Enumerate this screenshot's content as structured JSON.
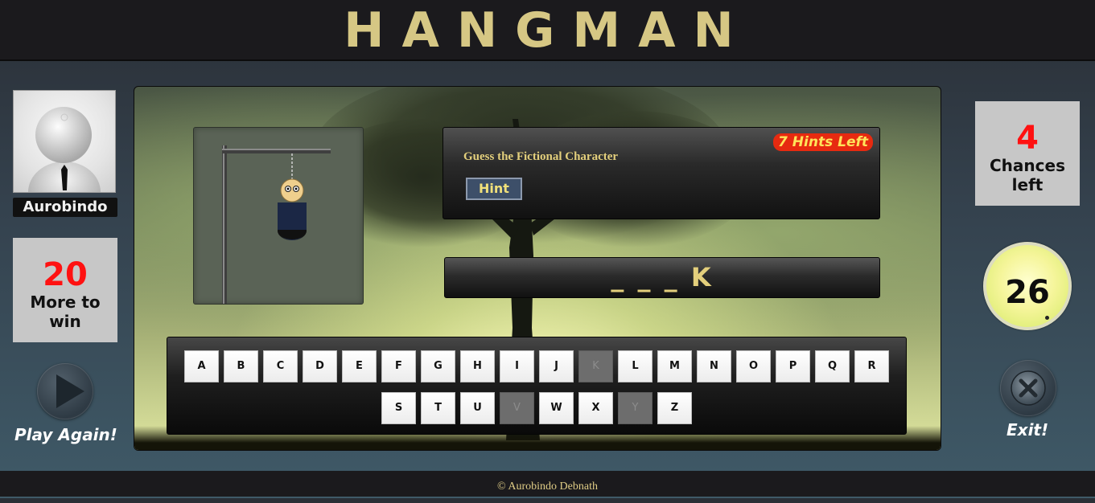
{
  "app": {
    "title": "HANGMAN"
  },
  "player": {
    "name": "Aurobindo"
  },
  "stats": {
    "more_to_win": "20",
    "more_to_win_label": "More to win",
    "chances_left": "4",
    "chances_left_label": "Chances left",
    "timer": "26"
  },
  "actions": {
    "play_again": "Play Again!",
    "exit": "Exit!"
  },
  "question": {
    "category": "Guess the Fictional Character",
    "hints_left": "7 Hints Left",
    "hint_button": "Hint"
  },
  "word": {
    "display": "_ _ _ K"
  },
  "keyboard": {
    "keys": [
      {
        "letter": "A",
        "used": false
      },
      {
        "letter": "B",
        "used": false
      },
      {
        "letter": "C",
        "used": false
      },
      {
        "letter": "D",
        "used": false
      },
      {
        "letter": "E",
        "used": false
      },
      {
        "letter": "F",
        "used": false
      },
      {
        "letter": "G",
        "used": false
      },
      {
        "letter": "H",
        "used": false
      },
      {
        "letter": "I",
        "used": false
      },
      {
        "letter": "J",
        "used": false
      },
      {
        "letter": "K",
        "used": true
      },
      {
        "letter": "L",
        "used": false
      },
      {
        "letter": "M",
        "used": false
      },
      {
        "letter": "N",
        "used": false
      },
      {
        "letter": "O",
        "used": false
      },
      {
        "letter": "P",
        "used": false
      },
      {
        "letter": "Q",
        "used": false
      },
      {
        "letter": "R",
        "used": false
      },
      {
        "letter": "S",
        "used": false
      },
      {
        "letter": "T",
        "used": false
      },
      {
        "letter": "U",
        "used": false
      },
      {
        "letter": "V",
        "used": true
      },
      {
        "letter": "W",
        "used": false
      },
      {
        "letter": "X",
        "used": false
      },
      {
        "letter": "Y",
        "used": true
      },
      {
        "letter": "Z",
        "used": false
      }
    ]
  },
  "footer": {
    "copyright": "© Aurobindo Debnath"
  },
  "icons": {
    "play": "play-icon",
    "exit": "close-icon"
  }
}
